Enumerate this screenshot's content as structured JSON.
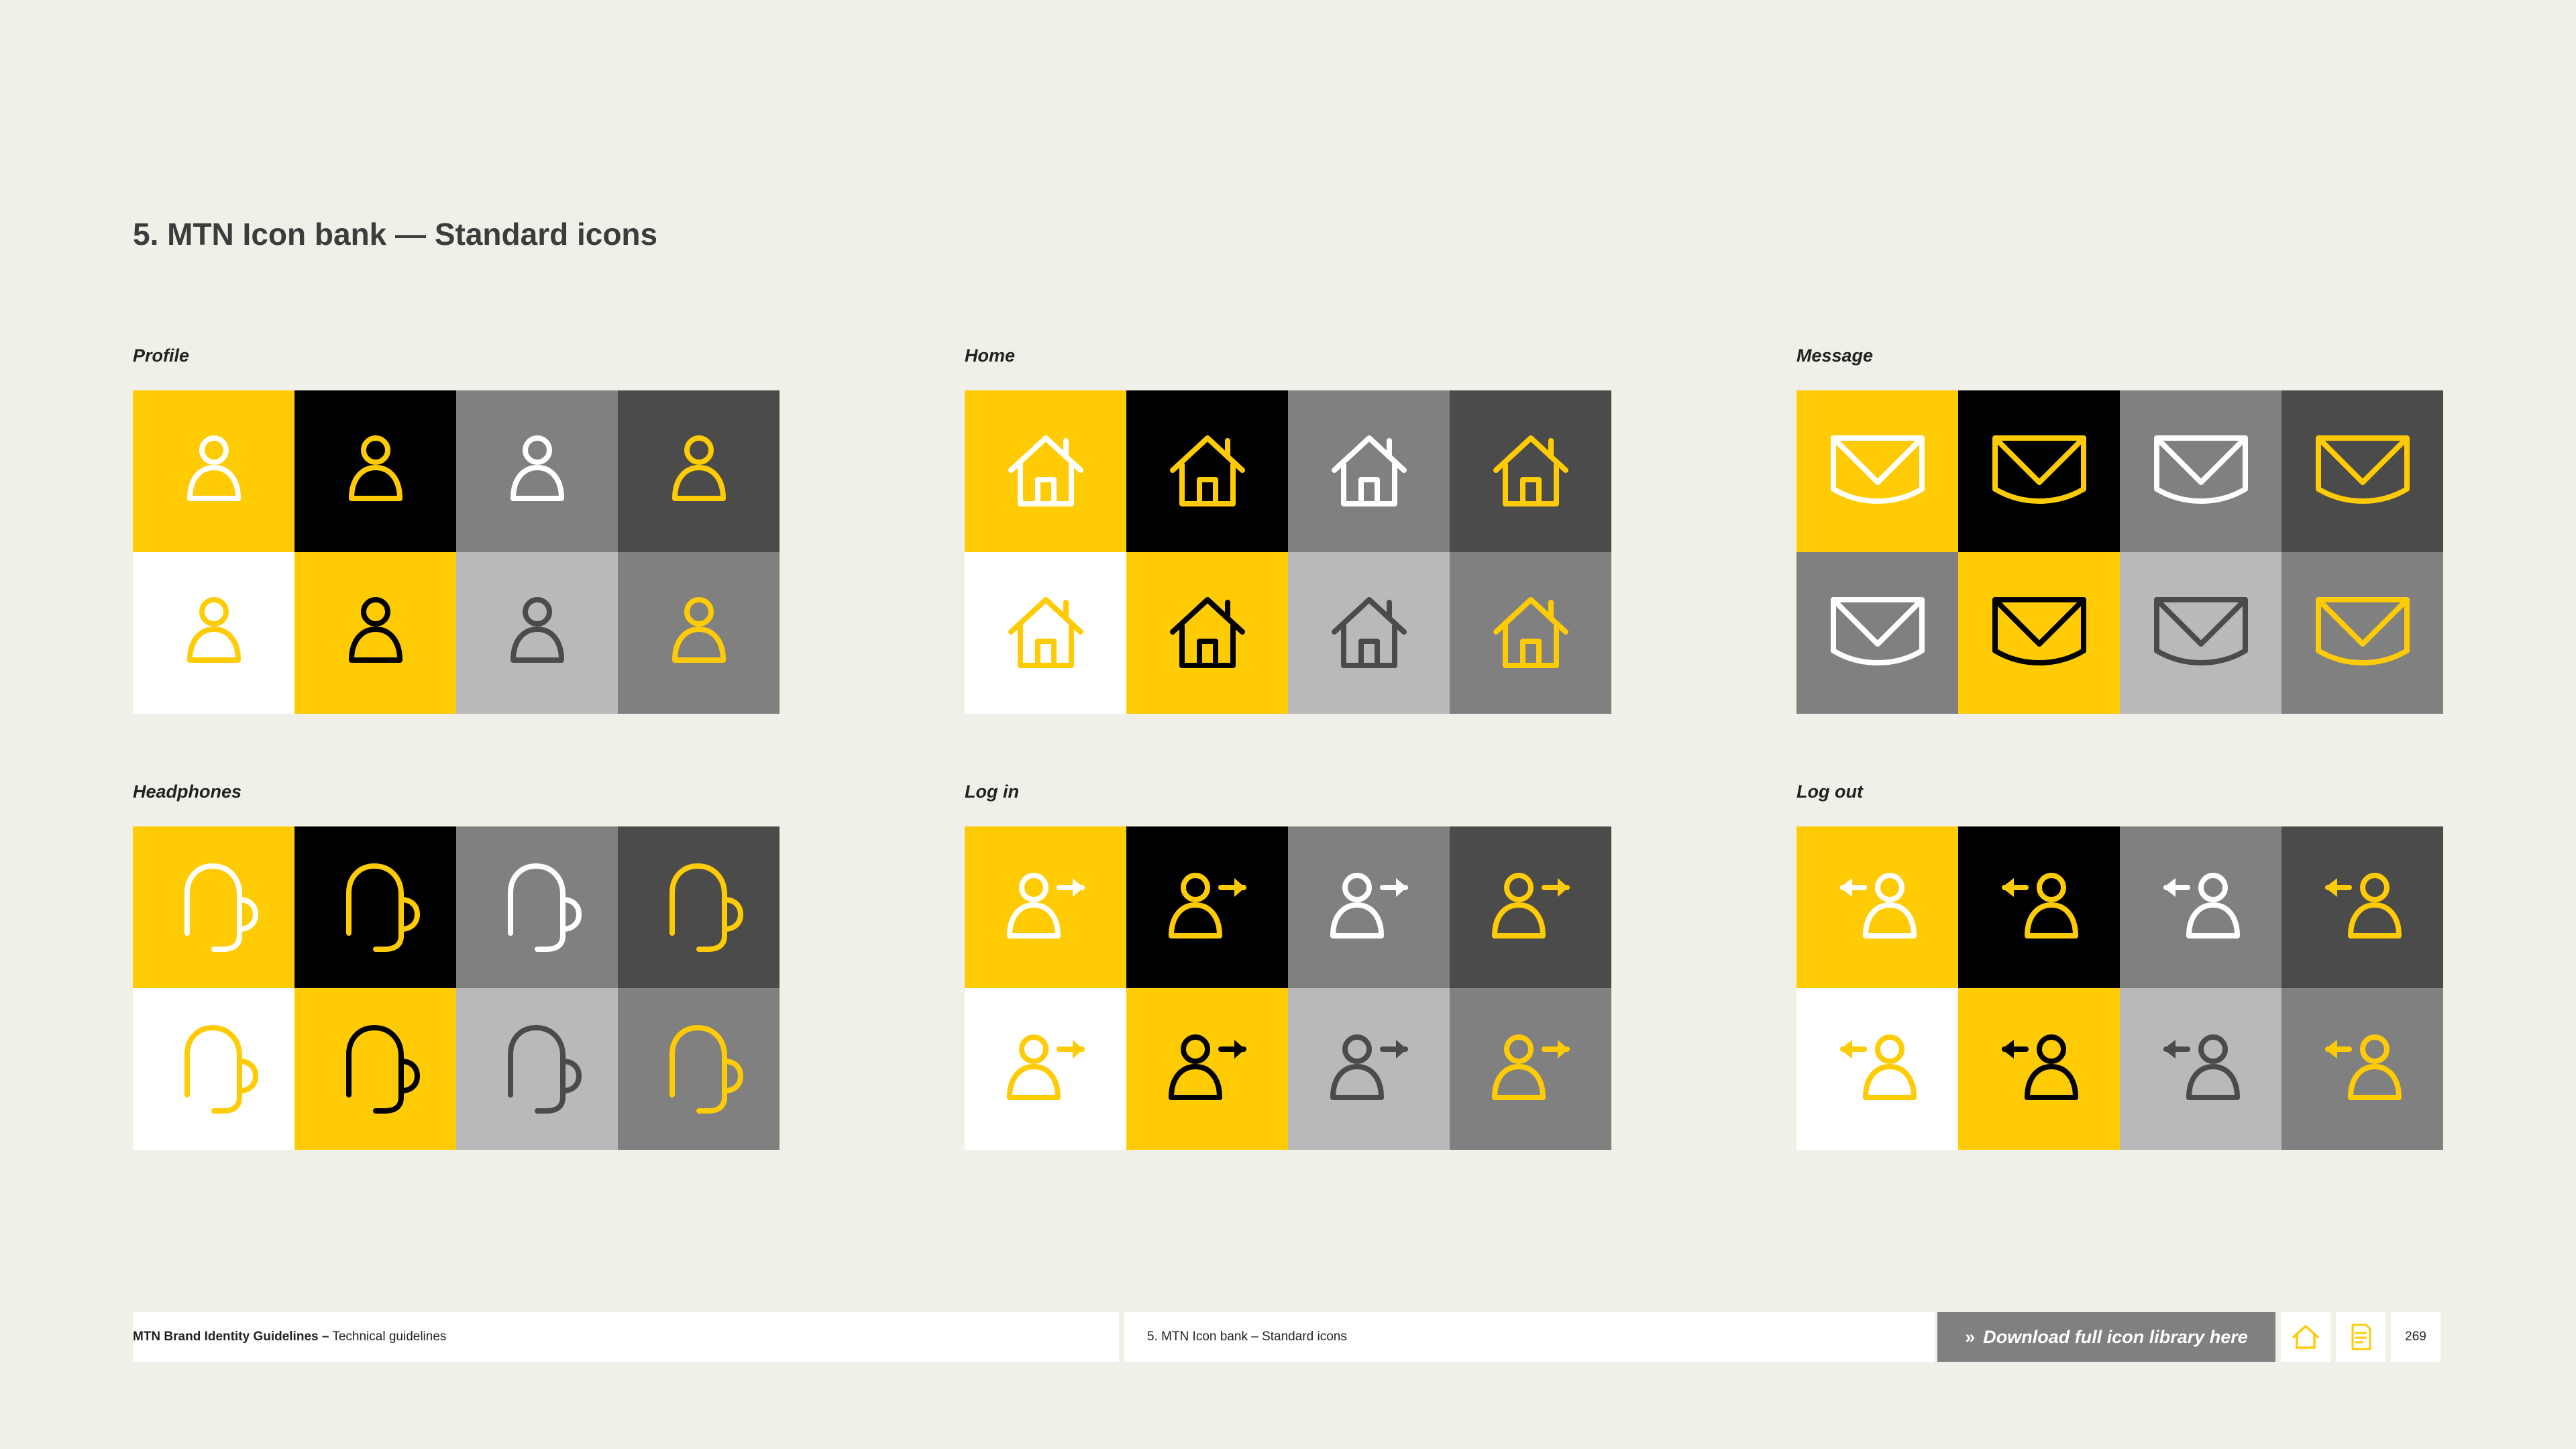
{
  "page_title": "5. MTN Icon bank — Standard icons",
  "colors": {
    "yellow": "#ffcb05",
    "black": "#000000",
    "white": "#ffffff",
    "mid_grey": "#808080",
    "dark_grey": "#4b4b4b",
    "light_grey": "#b9b9b9",
    "page_bg": "#f0efe8"
  },
  "sections": [
    {
      "label": "Profile",
      "icon": "profile-icon"
    },
    {
      "label": "Home",
      "icon": "home-icon"
    },
    {
      "label": "Message",
      "icon": "envelope-icon"
    },
    {
      "label": "Headphones",
      "icon": "headphones-icon"
    },
    {
      "label": "Log in",
      "icon": "login-icon"
    },
    {
      "label": "Log out",
      "icon": "logout-icon"
    }
  ],
  "tile_palettes": {
    "standard": [
      {
        "bg": "#ffcb05",
        "fg": "#ffffff"
      },
      {
        "bg": "#000000",
        "fg": "#ffcb05"
      },
      {
        "bg": "#808080",
        "fg": "#ffffff"
      },
      {
        "bg": "#4b4b4b",
        "fg": "#ffcb05"
      },
      {
        "bg": "#ffffff",
        "fg": "#ffcb05"
      },
      {
        "bg": "#ffcb05",
        "fg": "#000000"
      },
      {
        "bg": "#b9b9b9",
        "fg": "#4b4b4b"
      },
      {
        "bg": "#808080",
        "fg": "#ffcb05"
      }
    ],
    "message": [
      {
        "bg": "#ffcb05",
        "fg": "#ffffff"
      },
      {
        "bg": "#000000",
        "fg": "#ffcb05"
      },
      {
        "bg": "#808080",
        "fg": "#ffffff"
      },
      {
        "bg": "#4b4b4b",
        "fg": "#ffcb05"
      },
      {
        "bg": "#808080",
        "fg": "#ffffff"
      },
      {
        "bg": "#ffcb05",
        "fg": "#000000"
      },
      {
        "bg": "#b9b9b9",
        "fg": "#4b4b4b"
      },
      {
        "bg": "#808080",
        "fg": "#ffcb05"
      }
    ]
  },
  "footer": {
    "brand_bold": "MTN Brand Identity Guidelines –",
    "brand_rest": "Technical guidelines",
    "section_bold": "5. MTN Icon bank",
    "section_rest": "– Standard icons",
    "download_label": "Download full icon library here",
    "download_chevron": "»",
    "page_number": "269"
  }
}
